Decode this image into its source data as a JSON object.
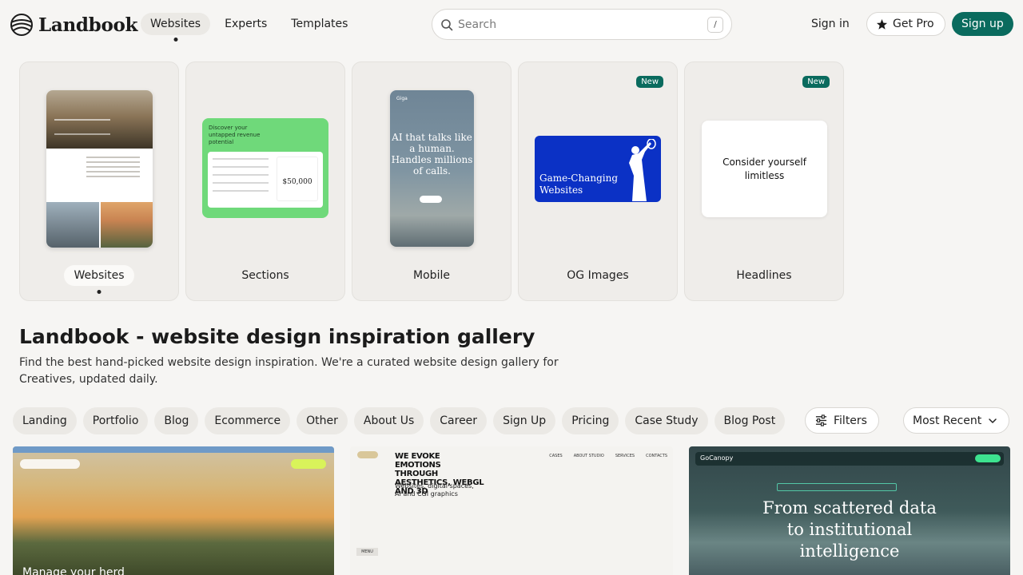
{
  "brand": {
    "name": "Landbook",
    "accent": "#0a6b5e"
  },
  "nav": [
    {
      "label": "Websites",
      "active": true
    },
    {
      "label": "Experts",
      "active": false
    },
    {
      "label": "Templates",
      "active": false
    }
  ],
  "search": {
    "placeholder": "Search",
    "shortcut": "/"
  },
  "auth": {
    "sign_in": "Sign in",
    "get_pro": "Get Pro",
    "sign_up": "Sign up"
  },
  "categories": [
    {
      "label": "Websites",
      "active": true,
      "badge": ""
    },
    {
      "label": "Sections",
      "active": false,
      "badge": ""
    },
    {
      "label": "Mobile",
      "active": false,
      "badge": ""
    },
    {
      "label": "OG Images",
      "active": false,
      "badge": "New"
    },
    {
      "label": "Headlines",
      "active": false,
      "badge": "New"
    }
  ],
  "thumbs": {
    "sections_title": "Discover your untapped revenue potential",
    "sections_value": "$50,000",
    "mobile_logo": "Giga",
    "mobile_text": "AI that talks like a human. Handles millions of calls.",
    "og_text": "Game-Changing Websites",
    "headline_text": "Consider yourself limitless"
  },
  "hero": {
    "title": "Landbook - website design inspiration gallery",
    "description": "Find the best hand-picked website design inspiration. We're a curated website design gallery for Creatives, updated daily."
  },
  "tags": [
    "Landing",
    "Portfolio",
    "Blog",
    "Ecommerce",
    "Other",
    "About Us",
    "Career",
    "Sign Up",
    "Pricing",
    "Case Study",
    "Blog Post"
  ],
  "controls": {
    "filters": "Filters",
    "sort": "Most Recent"
  },
  "gallery": {
    "shot1_text": "Manage your herd",
    "shot2_heading": "WE EVOKE EMOTIONS THROUGH AESTHETICS, WEBGL AND 3D",
    "shot2_sub": "Websites, digital spaces, AI and CGI graphics",
    "shot2_nav": [
      "CASES",
      "ABOUT STUDIO",
      "SERVICES",
      "CONTACTS"
    ],
    "shot2_menu": "MENU",
    "shot3_logo": "GoCanopy",
    "shot3_title": "From scattered data to institutional intelligence"
  }
}
